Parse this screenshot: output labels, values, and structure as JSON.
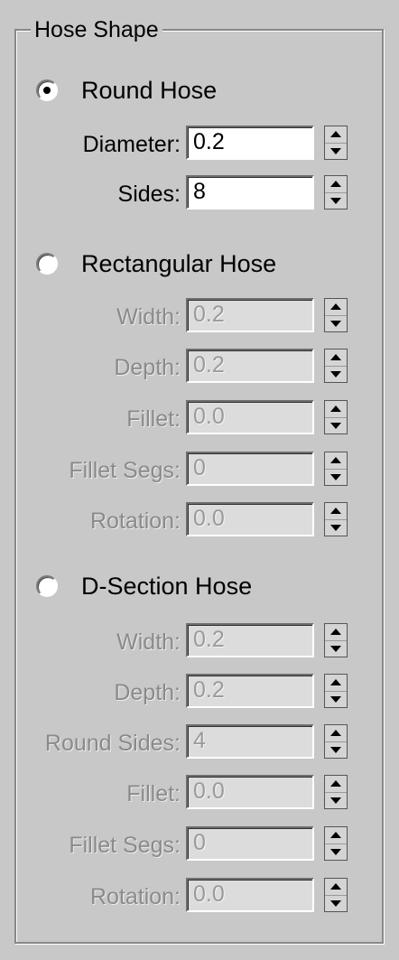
{
  "group": {
    "title": "Hose Shape"
  },
  "round": {
    "label": "Round Hose",
    "selected": true,
    "fields": [
      {
        "label": "Diameter:",
        "value": "0.2"
      },
      {
        "label": "Sides:",
        "value": "8"
      }
    ]
  },
  "rectangular": {
    "label": "Rectangular Hose",
    "selected": false,
    "fields": [
      {
        "label": "Width:",
        "value": "0.2"
      },
      {
        "label": "Depth:",
        "value": "0.2"
      },
      {
        "label": "Fillet:",
        "value": "0.0"
      },
      {
        "label": "Fillet Segs:",
        "value": "0"
      },
      {
        "label": "Rotation:",
        "value": "0.0"
      }
    ]
  },
  "dsection": {
    "label": "D-Section Hose",
    "selected": false,
    "fields": [
      {
        "label": "Width:",
        "value": "0.2"
      },
      {
        "label": "Depth:",
        "value": "0.2"
      },
      {
        "label": "Round Sides:",
        "value": "4"
      },
      {
        "label": "Fillet:",
        "value": "0.0"
      },
      {
        "label": "Fillet Segs:",
        "value": "0"
      },
      {
        "label": "Rotation:",
        "value": "0.0"
      }
    ]
  }
}
